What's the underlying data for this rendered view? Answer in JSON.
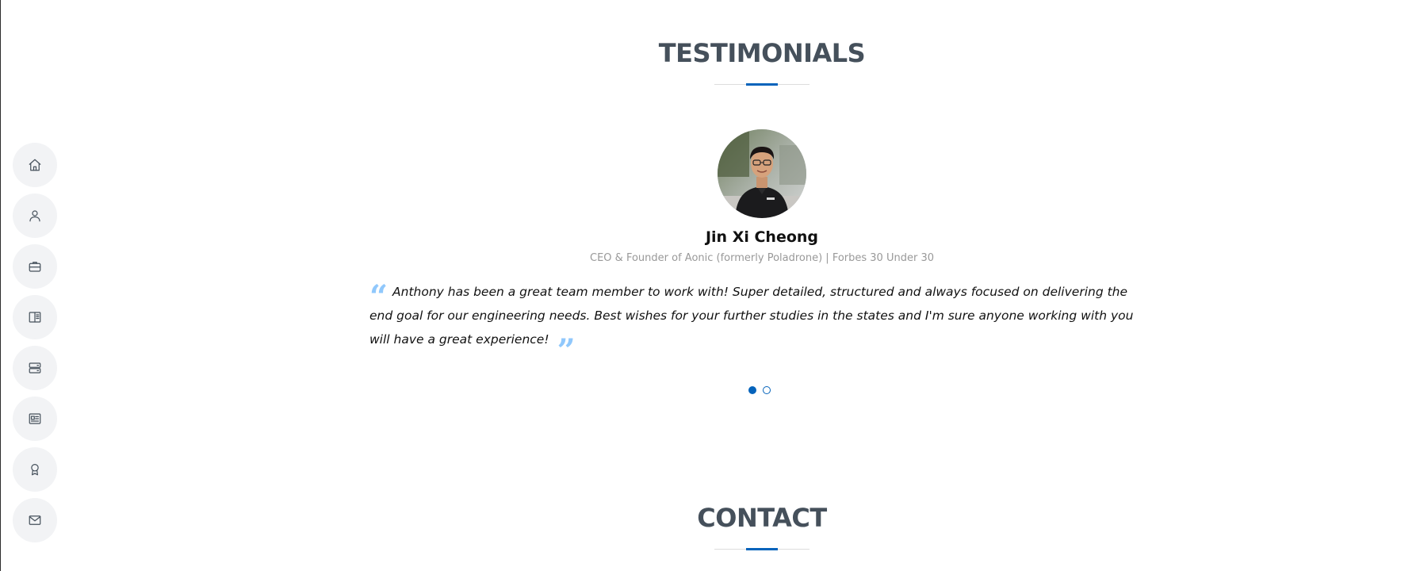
{
  "nav": {
    "items": [
      {
        "icon": "home-icon"
      },
      {
        "icon": "person-icon"
      },
      {
        "icon": "briefcase-icon"
      },
      {
        "icon": "book-icon"
      },
      {
        "icon": "server-icon"
      },
      {
        "icon": "newspaper-icon"
      },
      {
        "icon": "award-icon"
      },
      {
        "icon": "envelope-icon"
      }
    ]
  },
  "testimonials": {
    "title": "TESTIMONIALS",
    "name": "Jin Xi Cheong",
    "role": "CEO & Founder of Aonic (formerly Poladrone) | Forbes 30 Under 30",
    "quote": "Anthony has been a great team member to work with! Super detailed, structured and always focused on delivering the end goal for our engineering needs. Best wishes for your further studies in the states and I'm sure anyone working with you will have a great experience!",
    "open_quote": "“",
    "close_quote": "”",
    "pagination": {
      "current": 1,
      "total": 2
    }
  },
  "contact": {
    "title": "CONTACT"
  },
  "colors": {
    "accent": "#0563bb",
    "quote_icon": "#90c8fc",
    "heading": "#45505b"
  }
}
